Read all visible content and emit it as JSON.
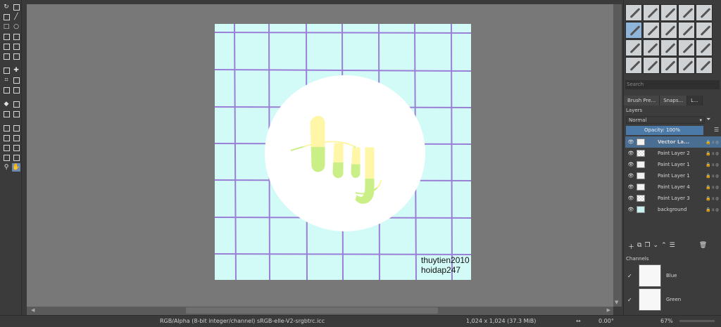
{
  "toolbox": {
    "tools": [
      "transform-icon",
      "calligraphy-icon",
      "brush-icon",
      "line-icon",
      "rectangle-icon",
      "ellipse-icon",
      "polygon-icon",
      "polyline-icon",
      "bezier-icon",
      "freehand-path-icon",
      "dynamic-brush-icon",
      "multibrush-icon",
      "crop-transform-icon",
      "move-icon",
      "crop-icon",
      "gradient-icon",
      "color-picker-icon",
      "smart-patch-icon",
      "fill-icon",
      "measure-icon",
      "assistant-icon",
      "reference-icon",
      "rect-select-icon",
      "ellipse-select-icon",
      "polygon-select-icon",
      "freehand-select-icon",
      "contiguous-select-icon",
      "similar-select-icon",
      "bezier-select-icon",
      "magnetic-select-icon",
      "zoom-icon",
      "pan-icon"
    ]
  },
  "canvas": {
    "watermark_line1": "thuytien2010",
    "watermark_line2": "hoidap247",
    "colors": {
      "background": "#d2fbf7",
      "grid": "#9a7fd6",
      "circle": "#ffffff",
      "letter_top": "#fff6a8",
      "letter_bottom": "#c9ef86"
    }
  },
  "docker": {
    "search_placeholder": "Search",
    "tabs": [
      "Brush Pre...",
      "Snaps...",
      "L..."
    ],
    "layers_title": "Layers",
    "blend_mode": "Normal",
    "opacity_label": "Opacity:  100%",
    "layers": [
      {
        "name": "Vector La...",
        "selected": true,
        "thumb": "white"
      },
      {
        "name": "Paint Layer 2",
        "selected": false,
        "thumb": "check"
      },
      {
        "name": "Paint Layer 1",
        "selected": false,
        "thumb": "white"
      },
      {
        "name": "Paint Layer 1",
        "selected": false,
        "thumb": "white"
      },
      {
        "name": "Paint Layer 4",
        "selected": false,
        "thumb": "white"
      },
      {
        "name": "Paint Layer 3",
        "selected": false,
        "thumb": "check"
      },
      {
        "name": "background",
        "selected": false,
        "thumb": "cyan"
      }
    ],
    "layer_flags": "α",
    "channels_title": "Channels",
    "channels": [
      {
        "name": "Blue"
      },
      {
        "name": "Green"
      }
    ]
  },
  "status": {
    "color_space": "RGB/Alpha (8-bit integer/channel)  sRGB-elle-V2-srgbtrc.icc",
    "dimensions": "1,024 x 1,024 (37.3 MiB)",
    "rotation": "0.00°",
    "zoom": "67%"
  }
}
